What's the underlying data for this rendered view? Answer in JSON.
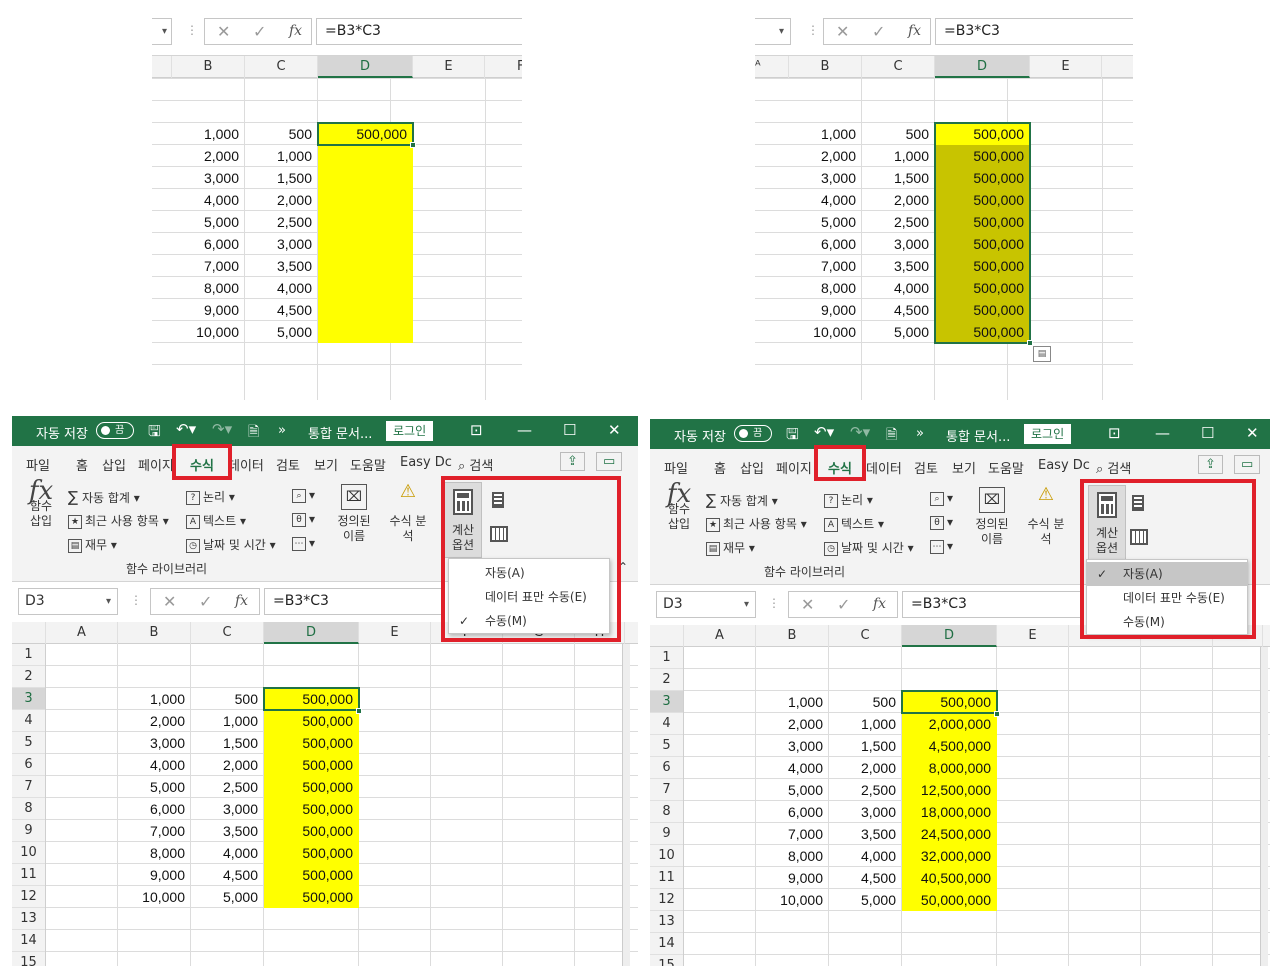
{
  "formula": {
    "name_box": "D3",
    "content": "=B3*C3",
    "fx": "fx"
  },
  "columns": [
    "A",
    "B",
    "C",
    "D",
    "E",
    "F",
    "G",
    "H"
  ],
  "col_b_values": [
    "1,000",
    "2,000",
    "3,000",
    "4,000",
    "5,000",
    "6,000",
    "7,000",
    "8,000",
    "9,000",
    "10,000"
  ],
  "col_c_values": [
    "500",
    "1,000",
    "1,500",
    "2,000",
    "2,500",
    "3,000",
    "3,500",
    "4,000",
    "4,500",
    "5,000"
  ],
  "top_left_d": [
    "500,000"
  ],
  "manual_d": [
    "500,000",
    "500,000",
    "500,000",
    "500,000",
    "500,000",
    "500,000",
    "500,000",
    "500,000",
    "500,000",
    "500,000"
  ],
  "auto_d": [
    "500,000",
    "2,000,000",
    "4,500,000",
    "8,000,000",
    "12,500,000",
    "18,000,000",
    "24,500,000",
    "32,000,000",
    "40,500,000",
    "50,000,000"
  ],
  "row_numbers": [
    "1",
    "2",
    "3",
    "4",
    "5",
    "6",
    "7",
    "8",
    "9",
    "10",
    "11",
    "12",
    "13",
    "14",
    "15"
  ],
  "window": {
    "autosave": "자동 저장",
    "autosave_toggle": "끔",
    "doc_title": "통합 문서...",
    "login": "로그인"
  },
  "tabs": [
    "파일",
    "홈",
    "삽입",
    "페이지",
    "수식",
    "데이터",
    "검토",
    "보기",
    "도움말",
    "Easy Dc"
  ],
  "search": "검색",
  "ribbon": {
    "insert_function": "함수\n삽입",
    "autosum": "자동 합계",
    "recent": "최근 사용 항목",
    "finance": "재무",
    "logic": "논리",
    "text": "텍스트",
    "datetime": "날짜 및 시간",
    "defined_names": "정의된\n이름",
    "formula_audit": "수식 분\n석",
    "calc_options": "계산\n옵션",
    "group_label": "함수 라이브러리"
  },
  "calc_menu": [
    "자동(A)",
    "데이터 표만 수동(E)",
    "수동(M)"
  ],
  "checked_left": "수동(M)",
  "checked_right": "자동(A)",
  "colors": {
    "accent": "#217346",
    "highlight": "#ffff00",
    "selection_fill": "#c8c400",
    "red_annotation": "#e0202a"
  }
}
